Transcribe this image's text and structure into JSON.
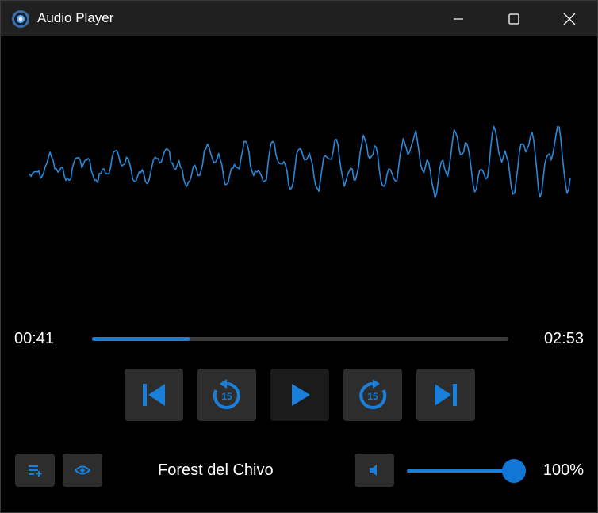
{
  "window": {
    "title": "Audio Player"
  },
  "icons": {
    "app": "audio-player-app-icon",
    "minimize": "minimize-icon",
    "maximize": "maximize-icon",
    "close": "close-icon",
    "previous": "skip-previous-icon",
    "rewind": "rewind-15-icon",
    "play": "play-icon",
    "forward": "forward-15-icon",
    "next": "skip-next-icon",
    "playlist": "playlist-add-icon",
    "visualizer": "eye-icon",
    "volume": "volume-icon"
  },
  "player": {
    "current_time": "00:41",
    "total_time": "02:53",
    "progress": 0.237,
    "track_title": "Forest del Chivo",
    "skip_seconds": "15",
    "volume_label": "100%",
    "volume": 1.0
  },
  "colors": {
    "accent": "#1a7fd8",
    "waveform": "#2a88d8",
    "button_bg": "#2d2d2d",
    "titlebar_bg": "#202020"
  }
}
